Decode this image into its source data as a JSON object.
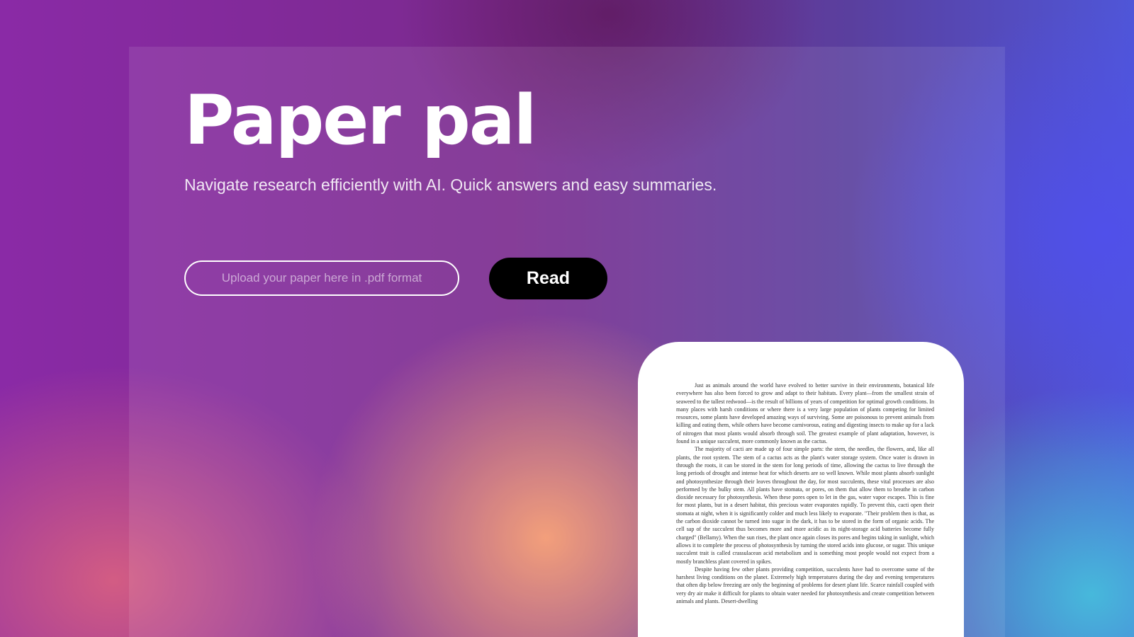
{
  "hero": {
    "title": "Paper pal",
    "subtitle": "Navigate research efficiently with AI. Quick answers and easy summaries."
  },
  "upload": {
    "placeholder": "Upload your paper here in .pdf format",
    "value": ""
  },
  "read_button": {
    "label": "Read"
  },
  "paper_preview": {
    "paragraphs": [
      "Just as animals around the world have evolved to better survive in their environments, botanical life everywhere has also been forced to grow and adapt to their habitats. Every plant—from the smallest strain of seaweed to the tallest redwood—is the result of billions of years of competition for optimal growth conditions. In many places with harsh conditions or where there is a very large population of plants competing for limited resources, some plants have developed amazing ways of surviving. Some are poisonous to prevent animals from killing and eating them, while others have become carnivorous, eating and digesting insects to make up for a lack of nitrogen that most plants would absorb through soil. The greatest example of plant adaptation, however, is found in a unique succulent, more commonly known as the cactus.",
      "The majority of cacti are made up of four simple parts: the stem, the needles, the flowers, and, like all plants, the root system. The stem of a cactus acts as the plant's water storage system. Once water is drawn in through the roots, it can be stored in the stem for long periods of time, allowing the cactus to live through the long periods of drought and intense heat for which deserts are so well known. While most plants absorb sunlight and photosynthesize through their leaves throughout the day, for most succulents, these vital processes are also performed by the bulky stem. All plants have stomata, or pores, on them that allow them to breathe in carbon dioxide necessary for photosynthesis. When these pores open to let in the gas, water vapor escapes. This is fine for most plants, but in a desert habitat, this precious water evaporates rapidly. To prevent this, cacti open their stomata at night, when it is significantly colder and much less likely to evaporate. \"Their problem then is that, as the carbon dioxide cannot be turned into sugar in the dark, it has to be stored in the form of organic acids. The cell sap of the succulent thus becomes more and more acidic as its night-storage acid batteries become fully charged\" (Bellamy). When the sun rises, the plant once again closes its pores and begins taking in sunlight, which allows it to complete the process of photosynthesis by turning the stored acids into glucose, or sugar. This unique succulent trait is called crassulacean acid metabolism and is something most people would not expect from a mostly branchless plant covered in spikes.",
      "Despite having few other plants providing competition, succulents have had to overcome some of the harshest living conditions on the planet. Extremely high temperatures during the day and evening temperatures that often dip below freezing are only the beginning of problems for desert plant life. Scarce rainfall coupled with very dry air make it difficult for plants to obtain water needed for photosynthesis and create competition between animals and plants. Desert-dwelling"
    ]
  }
}
